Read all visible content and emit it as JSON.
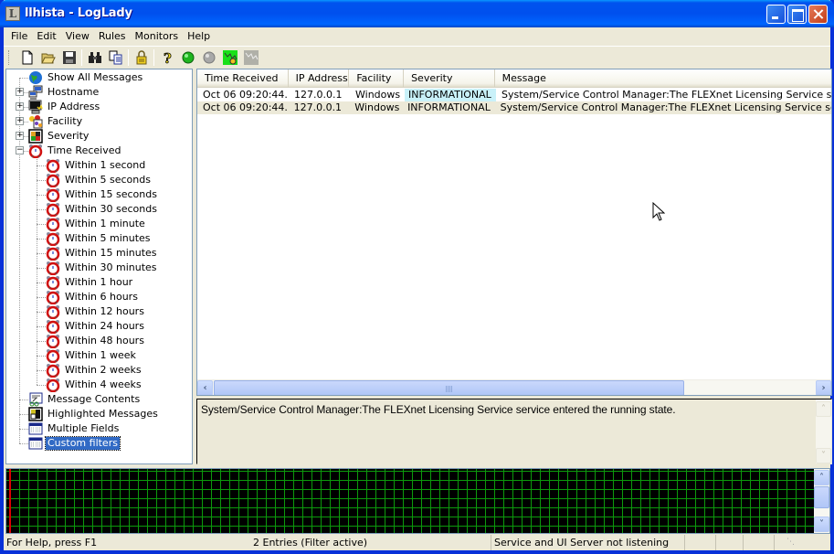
{
  "window": {
    "title": "llhista - LogLady",
    "app_icon_letter": "L",
    "controls": [
      "minimize",
      "maximize",
      "close"
    ]
  },
  "menu": [
    "File",
    "Edit",
    "View",
    "Rules",
    "Monitors",
    "Help"
  ],
  "toolbar": {
    "buttons": [
      {
        "name": "new",
        "icon": "new-document-icon"
      },
      {
        "name": "open",
        "icon": "open-folder-icon"
      },
      {
        "name": "save",
        "icon": "save-disk-icon"
      },
      {
        "name": "find",
        "icon": "binoculars-icon"
      },
      {
        "name": "copy",
        "icon": "copy-icon"
      },
      {
        "name": "lock",
        "icon": "padlock-icon"
      },
      {
        "name": "help",
        "icon": "help-question-icon"
      },
      {
        "name": "start",
        "icon": "green-light-icon"
      },
      {
        "name": "stop",
        "icon": "gray-light-icon"
      },
      {
        "name": "monitor-active",
        "icon": "monitor-active-icon"
      },
      {
        "name": "monitor-inactive",
        "icon": "monitor-inactive-icon"
      }
    ]
  },
  "tree": {
    "items": [
      {
        "label": "Show All Messages",
        "icon": "globe-icon",
        "level": 0,
        "expander": null
      },
      {
        "label": "Hostname",
        "icon": "network-computers-icon",
        "level": 0,
        "expander": "+"
      },
      {
        "label": "IP Address",
        "icon": "computer-ip-icon",
        "level": 0,
        "expander": "+"
      },
      {
        "label": "Facility",
        "icon": "facility-icon",
        "level": 0,
        "expander": "+"
      },
      {
        "label": "Severity",
        "icon": "severity-icon",
        "level": 0,
        "expander": "+"
      },
      {
        "label": "Time Received",
        "icon": "alarm-clock-icon",
        "level": 0,
        "expander": "-"
      },
      {
        "label": "Within 1 second",
        "icon": "alarm-clock-icon",
        "level": 1
      },
      {
        "label": "Within 5 seconds",
        "icon": "alarm-clock-icon",
        "level": 1
      },
      {
        "label": "Within 15 seconds",
        "icon": "alarm-clock-icon",
        "level": 1
      },
      {
        "label": "Within 30 seconds",
        "icon": "alarm-clock-icon",
        "level": 1
      },
      {
        "label": "Within 1 minute",
        "icon": "alarm-clock-icon",
        "level": 1
      },
      {
        "label": "Within 5 minutes",
        "icon": "alarm-clock-icon",
        "level": 1
      },
      {
        "label": "Within 15 minutes",
        "icon": "alarm-clock-icon",
        "level": 1
      },
      {
        "label": "Within 30 minutes",
        "icon": "alarm-clock-icon",
        "level": 1
      },
      {
        "label": "Within 1 hour",
        "icon": "alarm-clock-icon",
        "level": 1
      },
      {
        "label": "Within 6 hours",
        "icon": "alarm-clock-icon",
        "level": 1
      },
      {
        "label": "Within 12 hours",
        "icon": "alarm-clock-icon",
        "level": 1
      },
      {
        "label": "Within 24 hours",
        "icon": "alarm-clock-icon",
        "level": 1
      },
      {
        "label": "Within 48 hours",
        "icon": "alarm-clock-icon",
        "level": 1
      },
      {
        "label": "Within 1 week",
        "icon": "alarm-clock-icon",
        "level": 1
      },
      {
        "label": "Within 2 weeks",
        "icon": "alarm-clock-icon",
        "level": 1
      },
      {
        "label": "Within 4 weeks",
        "icon": "alarm-clock-icon",
        "level": 1
      },
      {
        "label": "Message Contents",
        "icon": "message-contents-icon",
        "level": 0,
        "expander": null
      },
      {
        "label": "Highlighted Messages",
        "icon": "highlight-icon",
        "level": 0,
        "expander": null
      },
      {
        "label": "Multiple Fields",
        "icon": "table-fields-icon",
        "level": 0,
        "expander": null
      },
      {
        "label": "Custom filters",
        "icon": "table-fields-icon",
        "level": 0,
        "expander": null,
        "selected": true
      }
    ]
  },
  "list": {
    "columns": [
      "Time Received",
      "IP Address",
      "Facility",
      "Severity",
      "Message"
    ],
    "rows": [
      [
        "Oct 06 09:20:44...",
        "127.0.0.1",
        "Windows",
        "INFORMATIONAL",
        "System/Service Control Manager:The FLEXnet Licensing Service service was"
      ],
      [
        "Oct 06 09:20:44...",
        "127.0.0.1",
        "Windows",
        "INFORMATIONAL",
        "System/Service Control Manager:The FLEXnet Licensing Service service ent"
      ]
    ],
    "severity_highlight_color": "#c9f1f9"
  },
  "detail": {
    "text": "System/Service Control Manager:The FLEXnet Licensing Service service entered the running state."
  },
  "graph": {
    "grid_color": "#0c9a0c",
    "marker_color": "#e00000",
    "background": "#000000"
  },
  "statusbar": {
    "help": "For Help, press F1",
    "entries": "2 Entries (Filter active)",
    "server": "Service and UI Server not listening"
  }
}
